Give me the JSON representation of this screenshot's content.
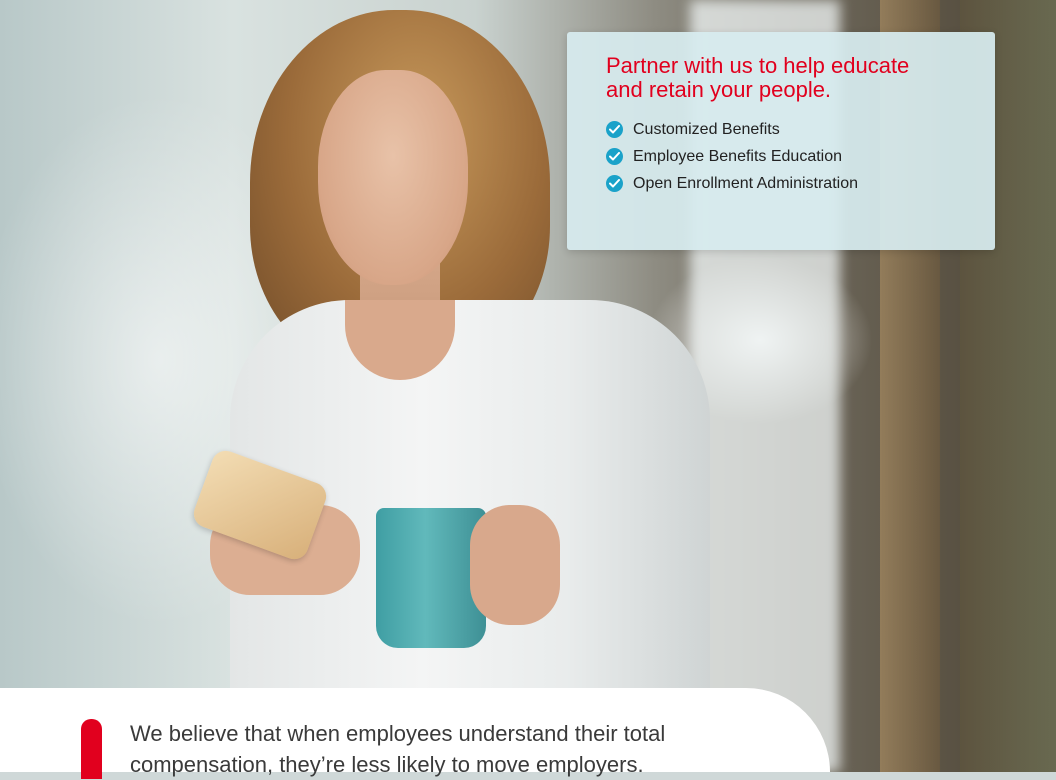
{
  "card": {
    "heading": "Partner with us to help educate and retain your people.",
    "items": [
      {
        "label": "Customized Benefits",
        "icon": "check-circle-icon"
      },
      {
        "label": "Employee Benefits Education",
        "icon": "check-circle-icon"
      },
      {
        "label": "Open Enrollment Administration",
        "icon": "check-circle-icon"
      }
    ]
  },
  "body_text": "We believe that when employees understand their total compensation, they’re less likely to move employers.",
  "colors": {
    "accent_red": "#e1001e",
    "check_blue": "#1aa2c9",
    "card_bg": "#d7ecef"
  }
}
